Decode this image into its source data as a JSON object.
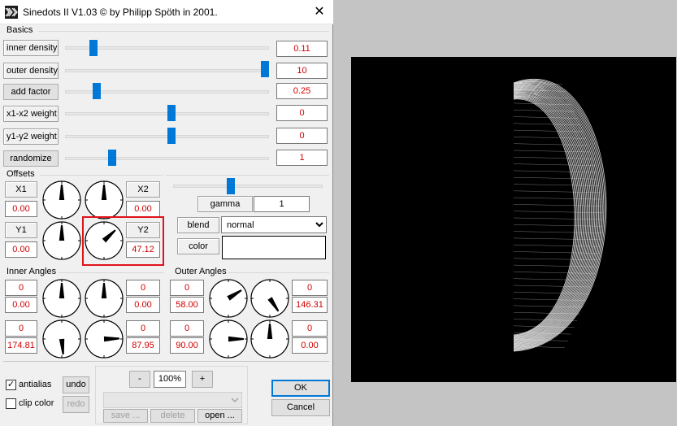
{
  "window": {
    "title": "Sinedots II V1.03 © by Philipp Spöth in 2001.",
    "close_glyph": "✕"
  },
  "basics": {
    "label": "Basics",
    "sliders": [
      {
        "label": "inner density",
        "value": "0.11",
        "level": 0.07
      },
      {
        "label": "outer density",
        "value": "10",
        "level": 1.0
      },
      {
        "label": "add factor",
        "value": "0.25",
        "level": 0.14
      },
      {
        "label": "x1-x2 weight",
        "value": "0",
        "level": 0.5
      },
      {
        "label": "y1-y2 weight",
        "value": "0",
        "level": 0.5
      },
      {
        "label": "randomize",
        "value": "1",
        "level": 0.22
      }
    ]
  },
  "offsets": {
    "label": "Offsets",
    "x1": {
      "label": "X1",
      "value": "0.00"
    },
    "x2": {
      "label": "X2",
      "value": "0.00"
    },
    "y1": {
      "label": "Y1",
      "value": "0.00"
    },
    "y2": {
      "label": "Y2",
      "value": "47.12"
    }
  },
  "color_panel": {
    "gamma_label": "gamma",
    "gamma_value": "1",
    "gamma_level": 0.38,
    "blend_label": "blend",
    "blend_value": "normal",
    "color_label": "color",
    "color_swatch": "#ffffff"
  },
  "inner_angles": {
    "label": "Inner Angles",
    "values": [
      {
        "top": "0",
        "bottom": "0.00"
      },
      {
        "top": "0",
        "bottom": "0.00"
      },
      {
        "top": "0",
        "bottom": "174.81"
      },
      {
        "top": "0",
        "bottom": "87.95"
      }
    ]
  },
  "outer_angles": {
    "label": "Outer Angles",
    "values": [
      {
        "top": "0",
        "bottom": "58.00"
      },
      {
        "top": "0",
        "bottom": "146.31"
      },
      {
        "top": "0",
        "bottom": "90.00"
      },
      {
        "top": "0",
        "bottom": "0.00"
      }
    ]
  },
  "bottom": {
    "antialias_label": "antialias",
    "antialias_checked": true,
    "antialias_mark": "✓",
    "clip_color_label": "clip color",
    "clip_color_checked": false,
    "undo_label": "undo",
    "redo_label": "redo",
    "zoom_minus": "-",
    "zoom_value": "100%",
    "zoom_plus": "+",
    "save_label": "save ...",
    "delete_label": "delete",
    "open_label": "open ...",
    "ok_label": "OK",
    "cancel_label": "Cancel"
  },
  "colors": {
    "accent": "#0078d7",
    "value_red": "#d00000",
    "highlight": "#e0121a",
    "preview_bg": "#000000"
  }
}
